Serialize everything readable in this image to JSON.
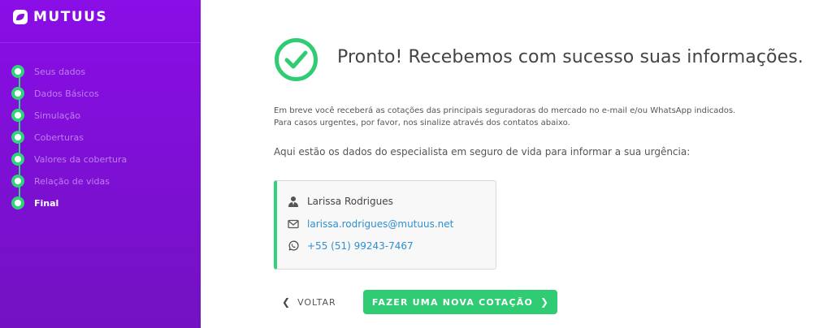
{
  "brand": {
    "name": "mutuus",
    "accent": "#30d37c",
    "sidebar_color": "#8a0ee6"
  },
  "sidebar": {
    "steps": [
      {
        "label": "Seus dados",
        "state": "done"
      },
      {
        "label": "Dados Básicos",
        "state": "done"
      },
      {
        "label": "Simulação",
        "state": "done"
      },
      {
        "label": "Coberturas",
        "state": "done"
      },
      {
        "label": "Valores da cobertura",
        "state": "done"
      },
      {
        "label": "Relação de vidas",
        "state": "done"
      },
      {
        "label": "Final",
        "state": "active"
      }
    ]
  },
  "main": {
    "title": "Pronto! Recebemos com sucesso suas informações.",
    "paragraph_1": "Em breve você receberá as cotações das principais seguradoras do mercado no e-mail e/ou WhatsApp indicados.",
    "paragraph_2": "Para casos urgentes, por favor, nos sinalize através dos contatos abaixo.",
    "intro": "Aqui estão os dados do especialista em seguro de vida para informar a sua urgência:",
    "specialist": {
      "name": "Larissa Rodrigues",
      "email": "larissa.rodrigues@mutuus.net",
      "phone": "+55 (51) 99243-7467",
      "icons": [
        "user-icon",
        "mail-icon",
        "whatsapp-icon"
      ]
    },
    "actions": {
      "back_label": "VOLTAR",
      "new_quote_label": "FAZER UMA NOVA COTAÇÃO"
    }
  }
}
